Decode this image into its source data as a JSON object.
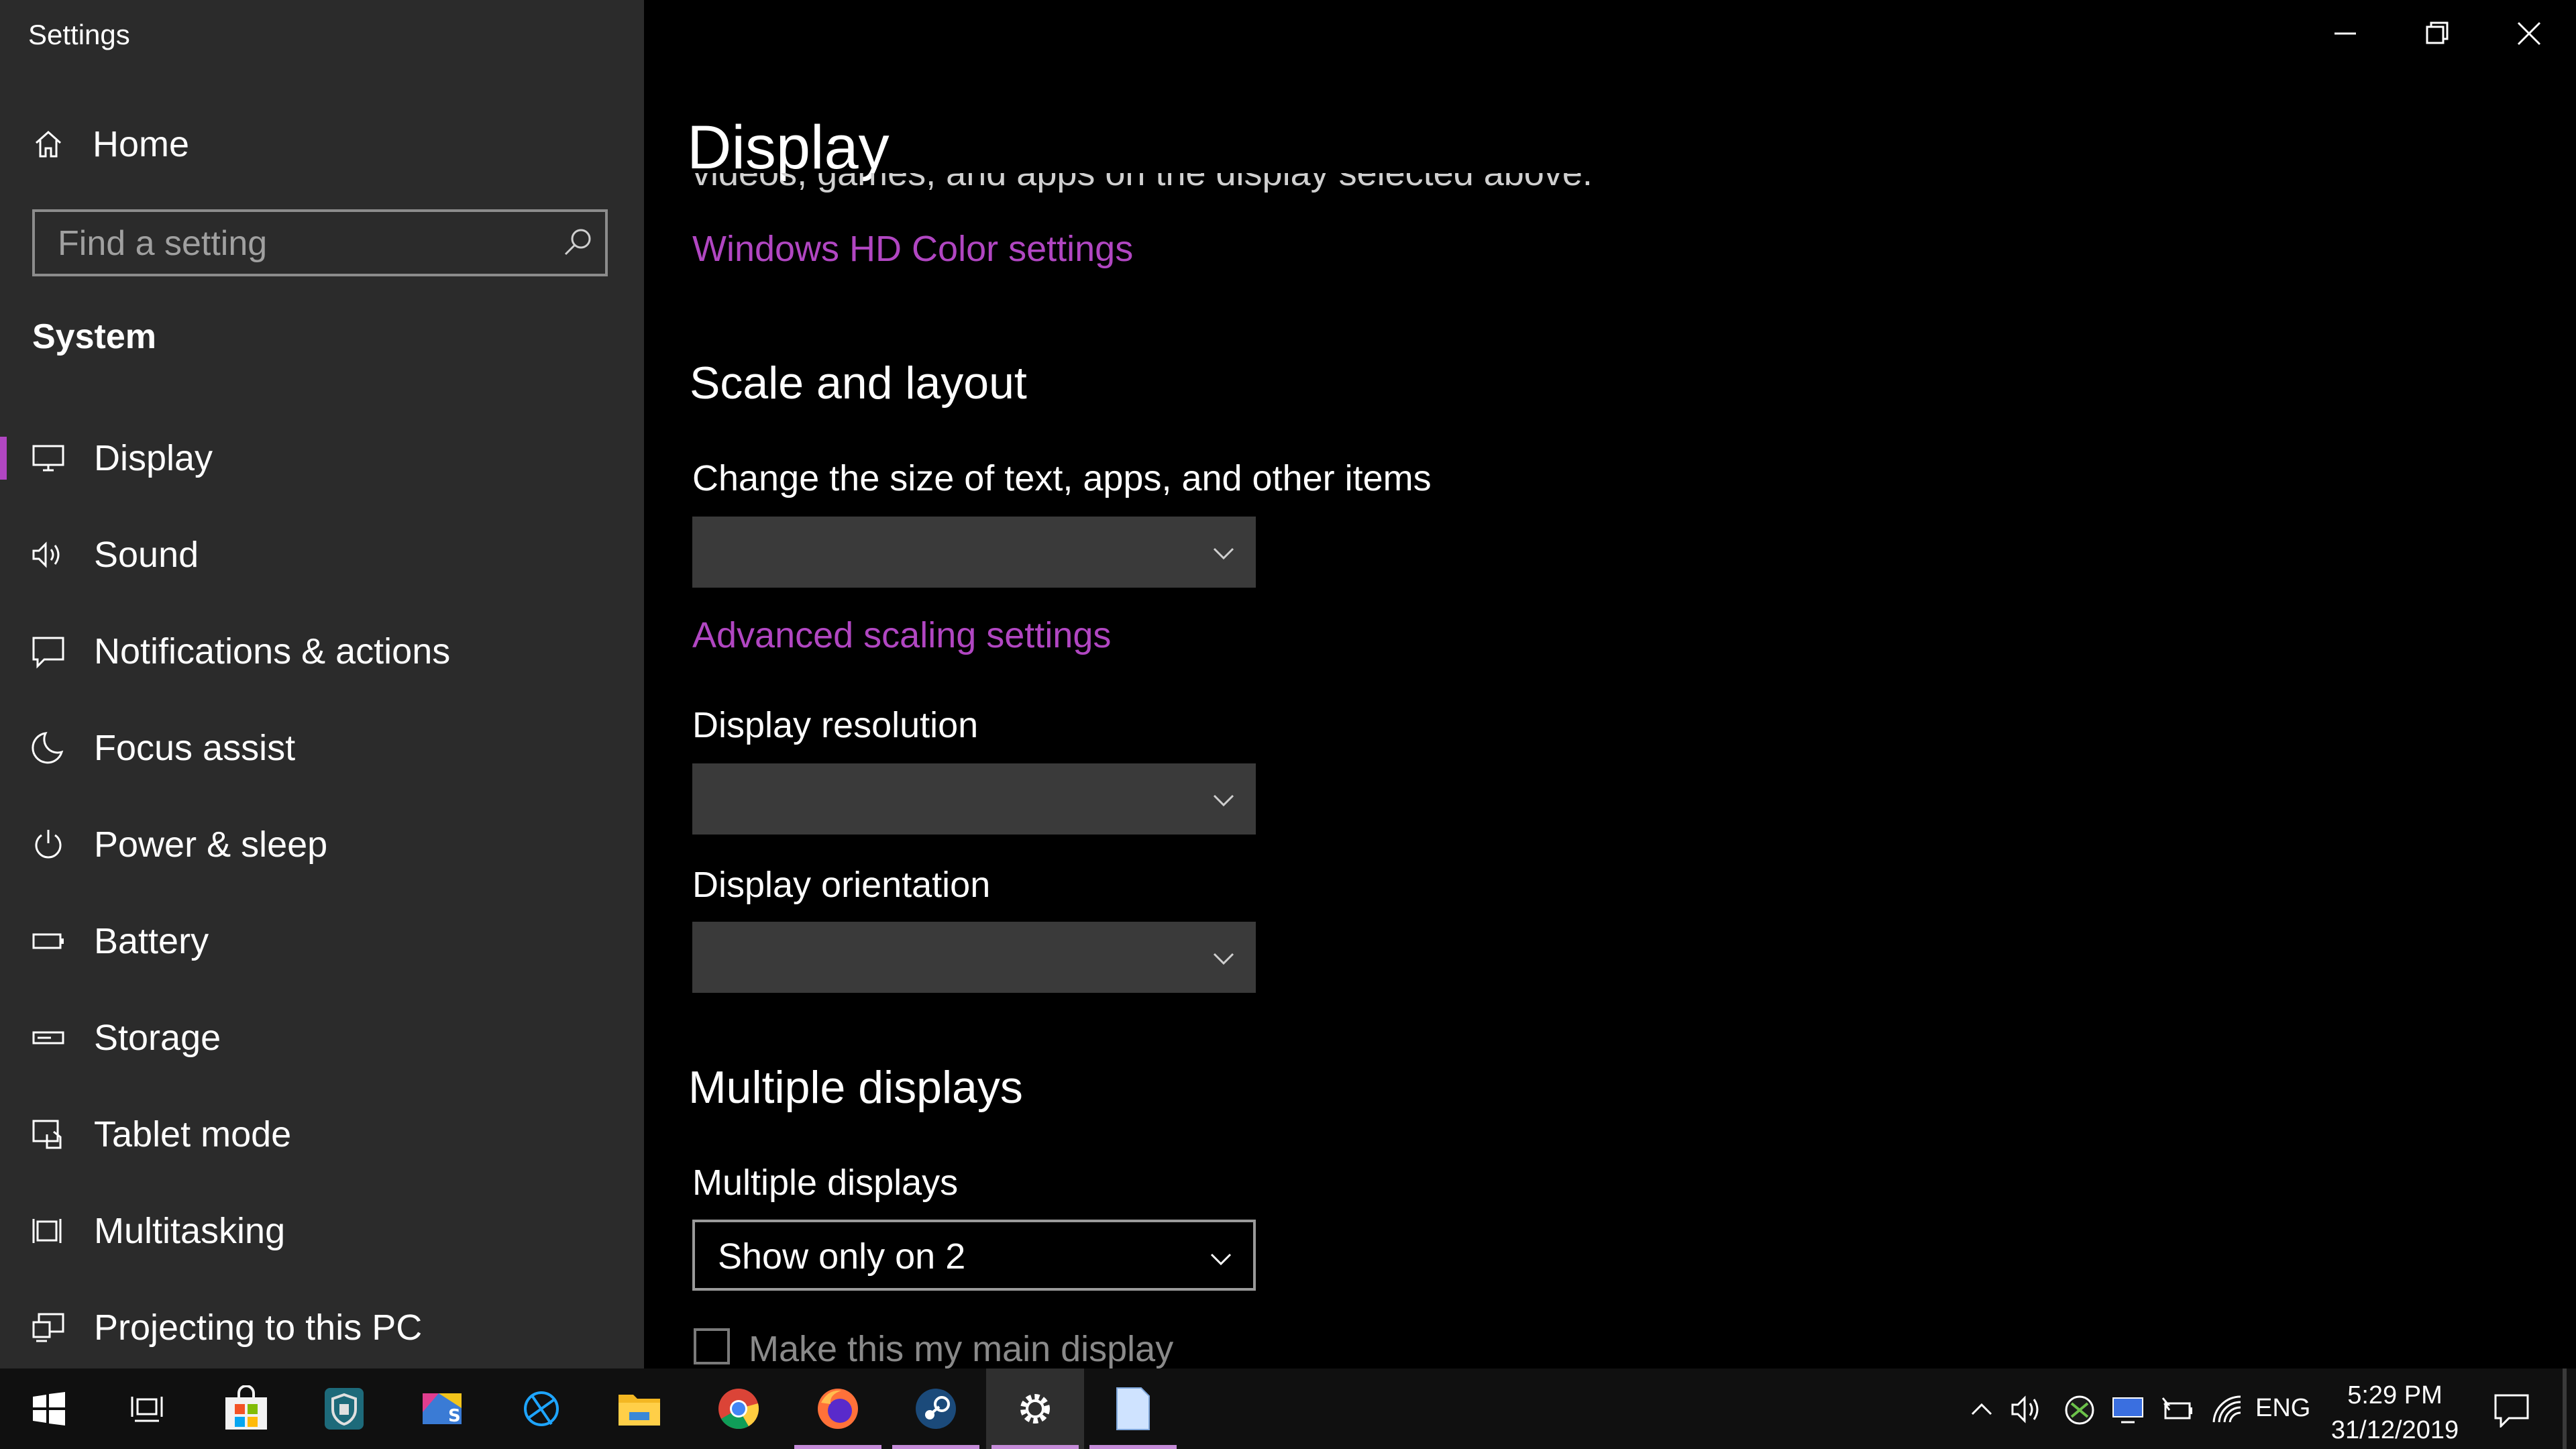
{
  "window": {
    "title": "Settings"
  },
  "sidebar": {
    "home_label": "Home",
    "search_placeholder": "Find a setting",
    "section_title": "System",
    "items": [
      {
        "label": "Display",
        "icon": "display-icon",
        "active": true
      },
      {
        "label": "Sound",
        "icon": "sound-icon"
      },
      {
        "label": "Notifications & actions",
        "icon": "notifications-icon"
      },
      {
        "label": "Focus assist",
        "icon": "moon-icon"
      },
      {
        "label": "Power & sleep",
        "icon": "power-icon"
      },
      {
        "label": "Battery",
        "icon": "battery-icon"
      },
      {
        "label": "Storage",
        "icon": "storage-icon"
      },
      {
        "label": "Tablet mode",
        "icon": "tablet-mode-icon"
      },
      {
        "label": "Multitasking",
        "icon": "multitasking-icon"
      },
      {
        "label": "Projecting to this PC",
        "icon": "projecting-icon"
      }
    ]
  },
  "main": {
    "page_title": "Display",
    "clipped_text": "videos, games, and apps on the display selected above.",
    "hd_color_link": "Windows HD Color settings",
    "scale_section": "Scale and layout",
    "size_label": "Change the size of text, apps, and other items",
    "size_value": "",
    "advanced_scaling_link": "Advanced scaling settings",
    "resolution_label": "Display resolution",
    "resolution_value": "",
    "orientation_label": "Display orientation",
    "orientation_value": "",
    "multiple_section": "Multiple displays",
    "multiple_label": "Multiple displays",
    "multiple_value": "Show only on 2",
    "main_display_checkbox": "Make this my main display"
  },
  "taskbar": {
    "apps": [
      "start-icon",
      "task-view-icon",
      "microsoft-store-icon",
      "security-app-icon",
      "photo-app-icon",
      "battle-net-icon",
      "file-explorer-icon",
      "chrome-icon",
      "firefox-icon",
      "steam-icon",
      "settings-icon",
      "notepad-icon"
    ],
    "language": "ENG",
    "time": "5:29 PM",
    "date": "31/12/2019"
  },
  "colors": {
    "accent": "#b146c2",
    "sidebar_bg": "#2b2b2b",
    "main_bg": "#000000",
    "dropdown_bg": "#3a3a3a"
  }
}
